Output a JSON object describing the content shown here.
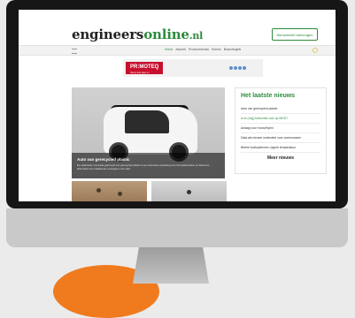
{
  "site": {
    "logo_main": "engineers",
    "logo_accent": "online",
    "logo_tld": ".nl",
    "newsletter_button": "Nieuwsbrief aanvragen"
  },
  "nav": {
    "links": [
      "Home",
      "Actueel",
      "Productnieuws",
      "Kennis",
      "Branchegids"
    ]
  },
  "banner": {
    "brand": "PR:MOTEQ",
    "tagline": "Heavy duty tape en lijmoplossingen"
  },
  "hero": {
    "title": "Auto van gerecycled plastic",
    "text": "De elektrische microauto gebouwd met gerecycled plastic is een duurzame oplossing voor het stadsverkeer en biedt een alternatief voor traditionele voertuigen in de stad."
  },
  "sidebar": {
    "title": "Het laatste nieuws",
    "items": [
      "Auto van gerecycled plastic",
      "Is er (nog) toekomst voor op MOS?",
      "Anlaag voor mono/hybrn",
      "Data als nieuwe onderdeel voor onmerwazen",
      "Betere koelsystemen, lagere temperatuur"
    ],
    "more": "Meer nieuws"
  },
  "colors": {
    "brand_green": "#2e8b3d",
    "banner_red": "#c8102e",
    "orange_accent": "#f07b1f"
  }
}
